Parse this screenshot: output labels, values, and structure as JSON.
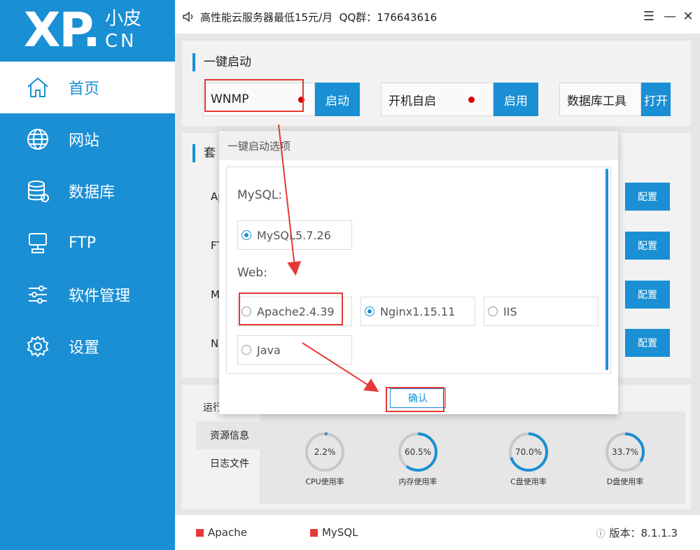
{
  "logo": {
    "main": "XP",
    "dot": ".",
    "cn_top": "小皮",
    "cn_bottom": "CN"
  },
  "sidebar": {
    "items": [
      {
        "label": "首页",
        "icon": "home-icon",
        "active": true
      },
      {
        "label": "网站",
        "icon": "globe-icon",
        "active": false
      },
      {
        "label": "数据库",
        "icon": "database-icon",
        "active": false
      },
      {
        "label": "FTP",
        "icon": "server-icon",
        "active": false
      },
      {
        "label": "软件管理",
        "icon": "sliders-icon",
        "active": false
      },
      {
        "label": "设置",
        "icon": "gear-icon",
        "active": false
      }
    ]
  },
  "titlebar": {
    "ad_text": "高性能云服务器最低15元/月  QQ群：176643616",
    "menu": "☰",
    "minimize": "—",
    "close": "✕"
  },
  "quick_start": {
    "title": "一键启动",
    "wnmp_label": "WNMP",
    "start_button": "启动",
    "autostart_label": "开机自启",
    "enable_button": "启用",
    "db_tool_label": "数据库工具",
    "open_button": "打开"
  },
  "suite": {
    "title_partial": "套",
    "rows": [
      {
        "label": "Ap",
        "button": "配置"
      },
      {
        "label": "FTP",
        "button": "配置"
      },
      {
        "label": "My",
        "button": "配置"
      },
      {
        "label": "Ng",
        "button": "配置"
      }
    ]
  },
  "bottom_tabs": [
    {
      "label": "运行",
      "active": false
    },
    {
      "label": "资源信息",
      "active": true
    },
    {
      "label": "日志文件",
      "active": false
    }
  ],
  "gauges": [
    {
      "value": "2.2%",
      "fraction": 0.022,
      "label": "CPU使用率"
    },
    {
      "value": "60.5%",
      "fraction": 0.605,
      "label": "内存使用率"
    },
    {
      "value": "70.0%",
      "fraction": 0.7,
      "label": "C盘使用率"
    },
    {
      "value": "33.7%",
      "fraction": 0.337,
      "label": "D盘使用率"
    }
  ],
  "footer": {
    "status1": "Apache",
    "status2": "MySQL",
    "version_label": "版本：8.1.1.3",
    "info_icon": "ⓘ"
  },
  "modal": {
    "title": "一键启动选项",
    "mysql_label": "MySQL:",
    "mysql_option": "MySQL5.7.26",
    "web_label": "Web:",
    "web_options": [
      {
        "label": "Apache2.4.39",
        "checked": false
      },
      {
        "label": "Nginx1.15.11",
        "checked": true
      },
      {
        "label": "IIS",
        "checked": false
      },
      {
        "label": "Java",
        "checked": false
      }
    ],
    "confirm_button": "确认"
  },
  "colors": {
    "accent": "#1a8fd4",
    "highlight": "#e53935",
    "status_dot": "#d40000"
  }
}
